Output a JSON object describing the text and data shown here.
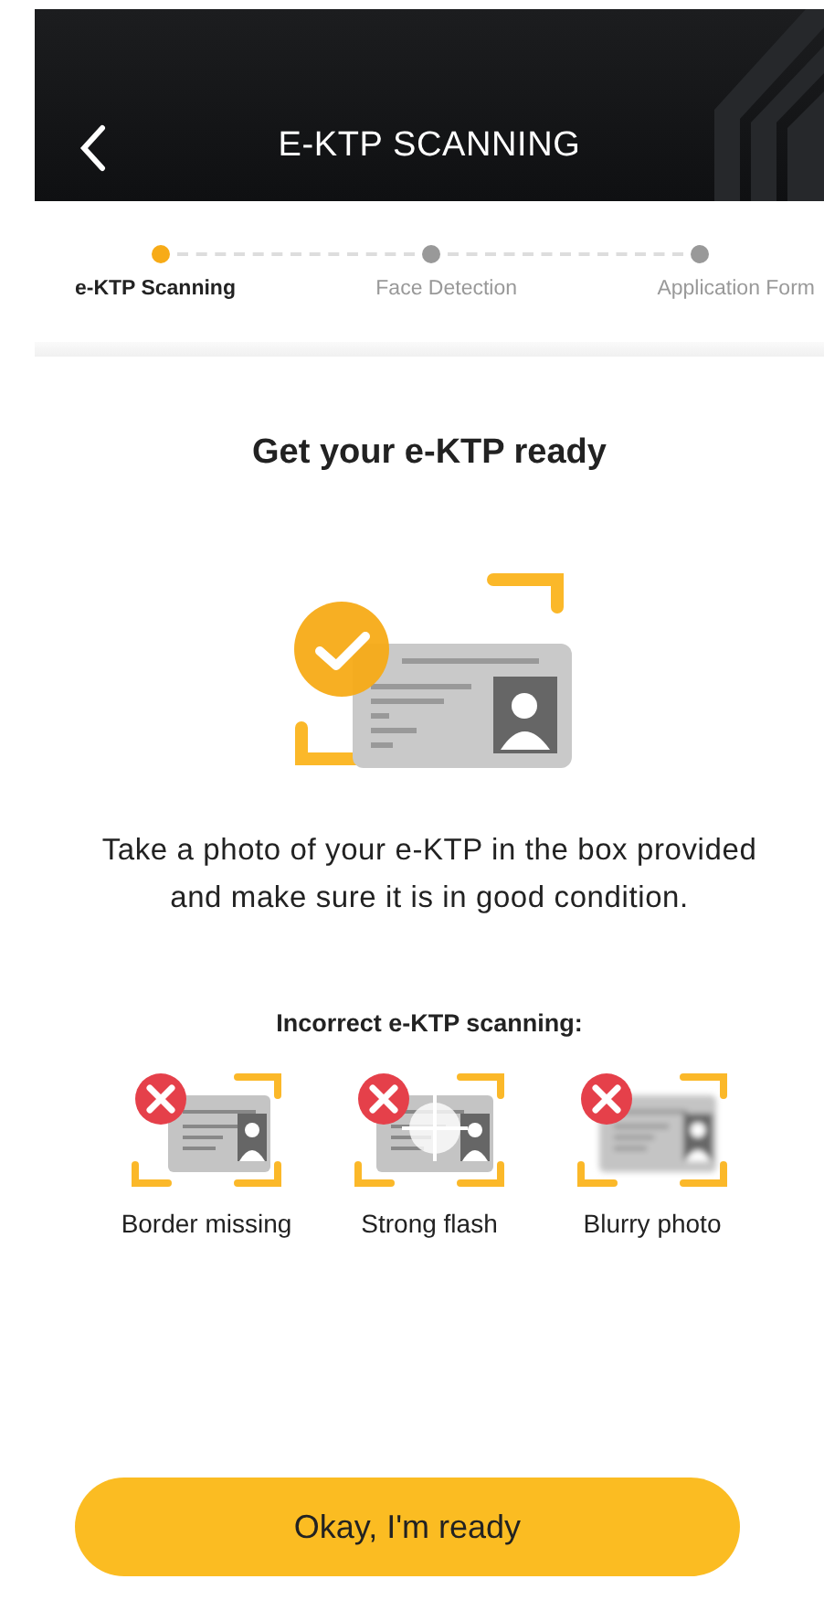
{
  "header": {
    "title": "E-KTP SCANNING"
  },
  "steps": [
    {
      "label": "e-KTP Scanning",
      "selected": true
    },
    {
      "label": "Face Detection",
      "selected": false
    },
    {
      "label": "Application Form",
      "selected": false
    }
  ],
  "heading": "Get your e-KTP ready",
  "description": "Take a photo of your e-KTP in the box provided and make sure it is in good condition.",
  "incorrect": {
    "title": "Incorrect e-KTP scanning:",
    "examples": [
      {
        "kind": "border_missing",
        "label": "Border missing"
      },
      {
        "kind": "strong_flash",
        "label": "Strong flash"
      },
      {
        "kind": "blurry",
        "label": "Blurry photo"
      }
    ]
  },
  "button": "Okay, I'm ready"
}
